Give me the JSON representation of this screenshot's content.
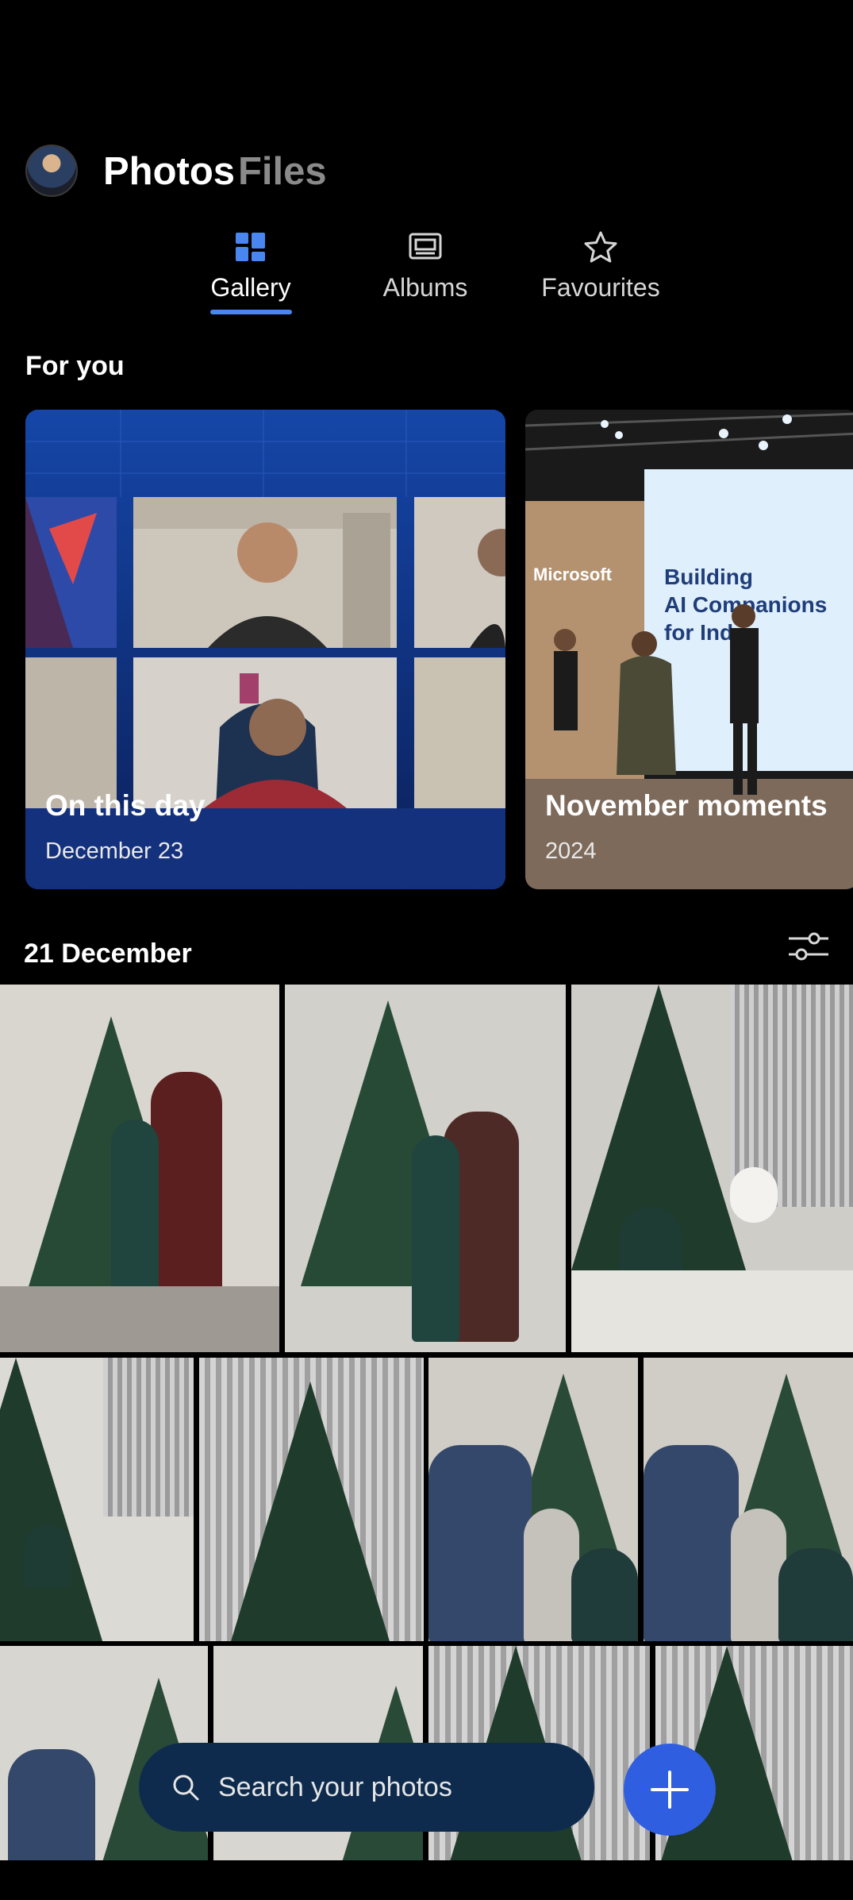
{
  "header": {
    "title": "Photos",
    "secondary_title": "Files"
  },
  "tabs": [
    {
      "label": "Gallery",
      "icon": "gallery-icon",
      "active": true
    },
    {
      "label": "Albums",
      "icon": "album-icon",
      "active": false
    },
    {
      "label": "Favourites",
      "icon": "star-icon",
      "active": false
    }
  ],
  "for_you": {
    "title": "For you",
    "cards": [
      {
        "title": "On this day",
        "subtitle": "December 23"
      },
      {
        "title": "November moments",
        "subtitle": "2024",
        "photo_text": "Building AI Companions for Ind",
        "logo_text": "Microsoft"
      }
    ]
  },
  "date_section": {
    "title": "21 December",
    "filter_icon": "sliders-icon"
  },
  "search": {
    "placeholder": "Search your photos",
    "icon": "search-icon"
  },
  "fab": {
    "icon": "plus-icon"
  },
  "colors": {
    "accent": "#4a86f0",
    "search_bg": "#0e2b4d",
    "fab_bg": "#2f5ee0"
  }
}
